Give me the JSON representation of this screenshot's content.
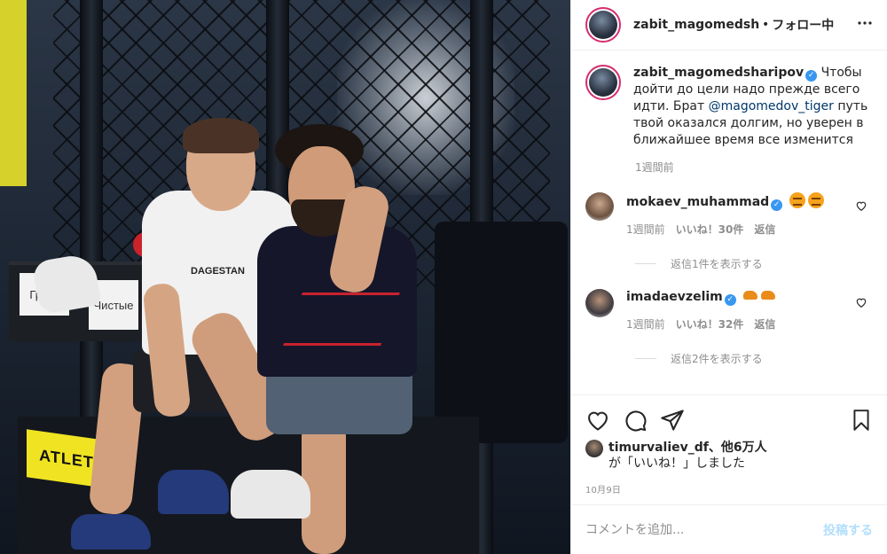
{
  "header": {
    "username": "zabit_magomedsharipov",
    "separator": "•",
    "follow_status": "フォロー中",
    "more_icon": "more-options-icon"
  },
  "photo": {
    "sign_left": "Грязь",
    "sign_right": "Чистые",
    "shirt_text": "DAGESTAN",
    "bench_brand": "ATLETIC"
  },
  "caption": {
    "username": "zabit_magomedsharipov",
    "text_before": "Чтобы дойти до цели надо прежде всего идти. Брат ",
    "mention": "@magomedov_tiger",
    "text_after": " путь твой оказался долгим, но уверен в ближайшее время все изменится",
    "time": "1週間前"
  },
  "comments": [
    {
      "username": "mokaev_muhammad",
      "time": "1週間前",
      "likes": "いいね！30件",
      "reply": "返信",
      "view_replies": "返信1件を表示する"
    },
    {
      "username": "imadaevzelim",
      "time": "1週間前",
      "likes": "いいね！32件",
      "reply": "返信",
      "view_replies": "返信2件を表示する"
    }
  ],
  "actions": {
    "liked_by_user": "timurvaliev_df",
    "liked_by_rest": "、他6万人",
    "liked_by_suffix": "が「いいね！」しました",
    "date": "10月9日"
  },
  "add_comment": {
    "placeholder": "コメントを追加...",
    "post_label": "投稿する"
  },
  "colors": {
    "verified": "#3897f0",
    "story_ring": "#d52d6e",
    "post_button_disabled": "#b2dffc",
    "mention": "#00376b"
  }
}
